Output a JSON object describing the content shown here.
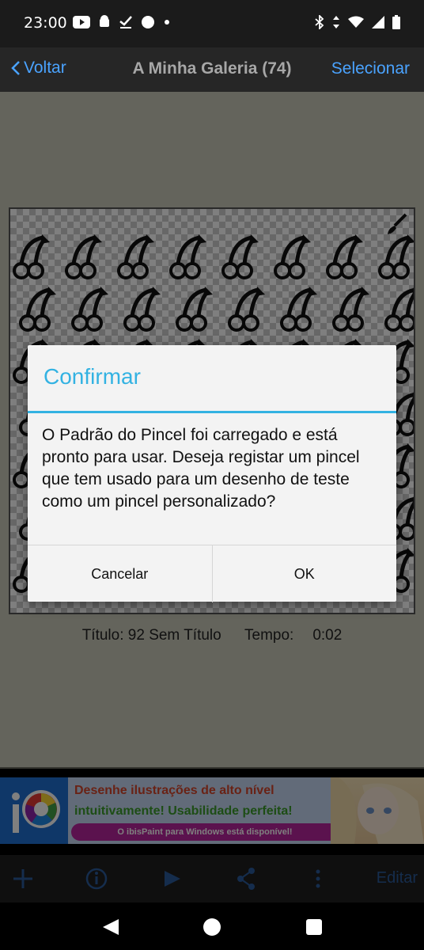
{
  "status_bar": {
    "time": "23:00",
    "left_icons": [
      "youtube-icon",
      "android-icon",
      "download-done-icon",
      "circle-icon",
      "dot-icon"
    ],
    "right_icons": [
      "bluetooth-icon",
      "data-arrows-icon",
      "wifi-icon",
      "cell-signal-icon",
      "battery-icon"
    ]
  },
  "nav": {
    "back_label": "Voltar",
    "title": "A Minha Galeria (74)",
    "select_label": "Selecionar"
  },
  "artwork": {
    "info": {
      "title": "Título: 92 Sem Título",
      "time_label": "Tempo:",
      "time_value": "0:02"
    }
  },
  "ad": {
    "line1": "Desenhe ilustrações de alto nível",
    "line2": "intuitivamente! Usabilidade perfeita!",
    "line3": "O ibisPaint para Windows está disponível!"
  },
  "toolbar": {
    "edit_label": "Editar",
    "icons": [
      "add-icon",
      "info-icon",
      "play-icon",
      "share-icon",
      "more-icon"
    ]
  },
  "dialog": {
    "title": "Confirmar",
    "message": "O Padrão do Pincel foi carregado e está pronto para usar. Deseja registar um pincel que tem usado para um desenho de teste como um pincel personalizado?",
    "cancel_label": "Cancelar",
    "ok_label": "OK"
  },
  "colors": {
    "accent": "#33b2e2",
    "link": "#4aa3ff"
  }
}
